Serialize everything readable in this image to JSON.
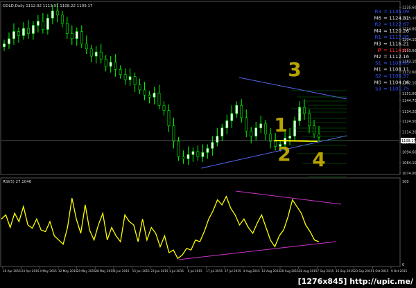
{
  "chart_data": [
    {
      "type": "candlestick",
      "title": "GOLD,Daily  1112.92 1113.91 1108.22 1109.17",
      "series": [
        {
          "name": "GOLD,Daily",
          "values": [
            1200,
            1205,
            1212,
            1208,
            1215,
            1210,
            1218,
            1222,
            1214,
            1225,
            1232,
            1228,
            1220,
            1210,
            1205,
            1212,
            1200,
            1195,
            1188,
            1192,
            1185,
            1178,
            1182,
            1175,
            1170,
            1165,
            1168,
            1160,
            1155,
            1150,
            1148,
            1152,
            1140,
            1135,
            1120,
            1105,
            1090,
            1088,
            1092,
            1095,
            1090,
            1094,
            1098,
            1104,
            1110,
            1118,
            1125,
            1132,
            1140,
            1128,
            1115,
            1110,
            1118,
            1122,
            1112,
            1105,
            1100,
            1102,
            1108,
            1110,
            1125,
            1138,
            1132,
            1120,
            1112,
            1109
          ]
        }
      ],
      "ylim": [
        1074,
        1240
      ],
      "ytick_labels": [
        "1235.60",
        "1225.10",
        "1214.60",
        "1204.10",
        "1193.60",
        "1183.10",
        "1172.60",
        "1162.10",
        "1151.60",
        "1144.70",
        "1134.20",
        "1124.50",
        "1114.20",
        "1104.00",
        "1094.60",
        "1084.10",
        "1074.00"
      ],
      "current_price": "1109.17",
      "pivots": [
        {
          "label": "R3",
          "value": "1135.09",
          "color": "#3355ff"
        },
        {
          "label": "M6",
          "value": "1124.31",
          "color": "#dddddd"
        },
        {
          "label": "R2",
          "value": "1122.67",
          "color": "#3355ff"
        },
        {
          "label": "M4",
          "value": "1120.26",
          "color": "#dddddd"
        },
        {
          "label": "R1",
          "value": "1117.85",
          "color": "#3355ff"
        },
        {
          "label": "M3",
          "value": "1116.21",
          "color": "#dddddd"
        },
        {
          "label": "P",
          "value": "1114.47",
          "color": "#ff2222"
        },
        {
          "label": "M2",
          "value": "1112.16",
          "color": "#dddddd"
        },
        {
          "label": "S1",
          "value": "1109.85",
          "color": "#3355ff"
        },
        {
          "label": "M1",
          "value": "1108.11",
          "color": "#dddddd"
        },
        {
          "label": "S2",
          "value": "1106.37",
          "color": "#3355ff"
        },
        {
          "label": "M0",
          "value": "1104.06",
          "color": "#dddddd"
        },
        {
          "label": "S3",
          "value": "1101.75",
          "color": "#3355ff"
        }
      ],
      "annotations": [
        "3",
        "1",
        "2",
        "4"
      ]
    },
    {
      "type": "line",
      "title": "RSI(5) 27.1046",
      "ylim": [
        0,
        100
      ],
      "ytick_labels": [
        "100",
        "0"
      ],
      "series": [
        {
          "name": "RSI(5)",
          "values": [
            55,
            60,
            45,
            62,
            52,
            70,
            48,
            44,
            55,
            42,
            40,
            52,
            35,
            30,
            25,
            45,
            80,
            55,
            38,
            72,
            42,
            30,
            48,
            62,
            30,
            45,
            35,
            28,
            60,
            52,
            48,
            28,
            55,
            30,
            45,
            38,
            22,
            35,
            15,
            18,
            8,
            12,
            20,
            18,
            30,
            28,
            40,
            55,
            65,
            78,
            72,
            82,
            68,
            60,
            48,
            55,
            45,
            38,
            50,
            60,
            45,
            30,
            22,
            35,
            42,
            58,
            78,
            70,
            62,
            48,
            40,
            30,
            28
          ]
        }
      ],
      "xtick_labels": [
        "16 Apr 2015",
        "24 Apr 2015",
        "4 May 2015",
        "12 May 2015",
        "20 May 2015",
        "28 May 2015",
        "5 Jun 2015",
        "15 Jun 2015",
        "23 Jun 2015",
        "1 Jul 2015",
        "9 Jul 2015",
        "17 Jul 2015",
        "27 Jul 2015",
        "4 Aug 2015",
        "12 Aug 2015",
        "20 Aug 2015",
        "28 Aug 2015",
        "7 Sep 2015",
        "15 Sep 2015",
        "23 Sep 2015",
        "1 Oct 2015",
        "9 Oct 2015"
      ]
    }
  ],
  "watermark": "[1276x845] http://upic.me/"
}
